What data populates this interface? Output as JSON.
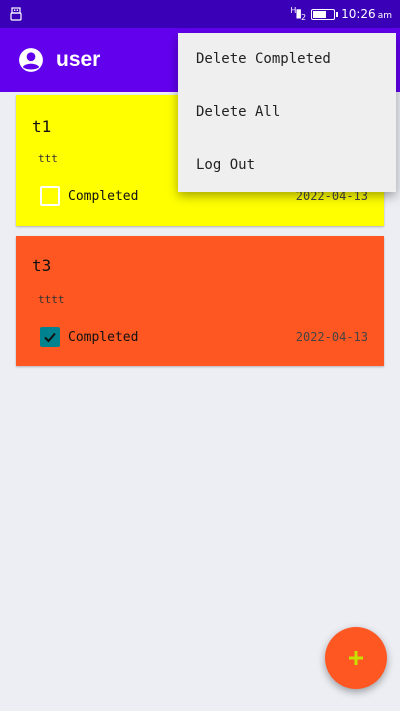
{
  "status_bar": {
    "signal": "H",
    "signal_sub": "2",
    "time": "10:26",
    "ampm": "am"
  },
  "app_bar": {
    "title": "user",
    "icon": "account-circle-icon",
    "color": "#6200ee"
  },
  "tasks": [
    {
      "title": "t1",
      "description": "ttt",
      "completed_label": "Completed",
      "completed": false,
      "date": "2022-04-13",
      "color": "#ffff00"
    },
    {
      "title": "t3",
      "description": "tttt",
      "completed_label": "Completed",
      "completed": true,
      "date": "2022-04-13",
      "color": "#ff5722"
    }
  ],
  "menu": {
    "items": [
      {
        "label": "Delete Completed"
      },
      {
        "label": "Delete All"
      },
      {
        "label": "Log Out"
      }
    ]
  },
  "fab": {
    "icon": "plus-icon",
    "color": "#ff5722",
    "icon_color": "#c6e000"
  }
}
